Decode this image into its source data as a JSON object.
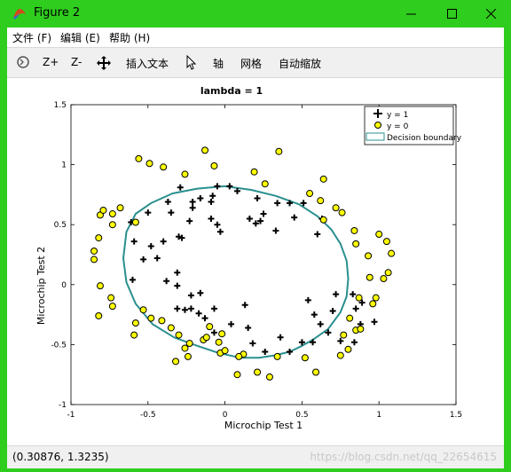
{
  "window": {
    "title": "Figure 2"
  },
  "menu": [
    {
      "label": "文件 (F)"
    },
    {
      "label": "编辑 (E)"
    },
    {
      "label": "帮助 (H)"
    }
  ],
  "toolbar": {
    "zoom_in": "Z+",
    "zoom_out": "Z-",
    "insert_text": "插入文本",
    "axis": "轴",
    "grid": "网格",
    "autoscale": "自动缩放"
  },
  "status": {
    "coordinates": "(0.30876, 1.3235)",
    "watermark": "https://blog.csdn.net/qq_22654615"
  },
  "colors": {
    "title_bar": "#2fcd1e",
    "boundary": "#2a8f8f",
    "negative_fill": "#ffff00"
  },
  "chart_data": {
    "type": "scatter",
    "title": "lambda = 1",
    "xlabel": "Microchip Test 1",
    "ylabel": "Microchip Test 2",
    "xlim": [
      -1,
      1.5
    ],
    "ylim": [
      -1,
      1.5
    ],
    "xticks": [
      "-1",
      "-0.5",
      "0",
      "0.5",
      "1",
      "1.5"
    ],
    "yticks": [
      "-1",
      "-0.5",
      "0",
      "0.5",
      "1",
      "1.5"
    ],
    "legend_position": "top-right",
    "legend": [
      "y = 1",
      "y = 0",
      "Decision boundary"
    ],
    "series": [
      {
        "name": "y = 1",
        "marker": "plus",
        "points": [
          [
            -0.09,
            0.69
          ],
          [
            -0.21,
            0.69
          ],
          [
            -0.29,
            0.81
          ],
          [
            -0.37,
            0.69
          ],
          [
            -0.09,
            0.55
          ],
          [
            0.16,
            0.55
          ],
          [
            0.08,
            0.78
          ],
          [
            0.21,
            0.72
          ],
          [
            0.2,
            0.51
          ],
          [
            0.33,
            0.45
          ],
          [
            0.34,
            0.68
          ],
          [
            0.42,
            0.68
          ],
          [
            0.23,
            0.53
          ],
          [
            0.03,
            0.82
          ],
          [
            -0.05,
            0.82
          ],
          [
            -0.08,
            0.74
          ],
          [
            -0.16,
            0.72
          ],
          [
            -0.21,
            0.64
          ],
          [
            -0.23,
            0.53
          ],
          [
            -0.28,
            0.39
          ],
          [
            -0.35,
            0.6
          ],
          [
            -0.5,
            0.6
          ],
          [
            -0.48,
            0.32
          ],
          [
            -0.59,
            0.36
          ],
          [
            -0.6,
            0.04
          ],
          [
            -0.61,
            0.52
          ],
          [
            -0.53,
            0.21
          ],
          [
            -0.44,
            0.22
          ],
          [
            -0.4,
            0.36
          ],
          [
            -0.38,
            0.03
          ],
          [
            -0.31,
            0.1
          ],
          [
            -0.31,
            -0.01
          ],
          [
            -0.31,
            -0.2
          ],
          [
            -0.26,
            -0.21
          ],
          [
            -0.22,
            -0.09
          ],
          [
            -0.16,
            -0.07
          ],
          [
            -0.17,
            -0.24
          ],
          [
            -0.22,
            -0.2
          ],
          [
            -0.13,
            -0.28
          ],
          [
            -0.07,
            -0.2
          ],
          [
            -0.07,
            -0.4
          ],
          [
            0.04,
            -0.33
          ],
          [
            0.13,
            -0.17
          ],
          [
            0.15,
            -0.36
          ],
          [
            0.18,
            -0.49
          ],
          [
            0.26,
            -0.56
          ],
          [
            0.36,
            -0.44
          ],
          [
            0.42,
            -0.56
          ],
          [
            0.5,
            -0.48
          ],
          [
            0.57,
            -0.48
          ],
          [
            0.62,
            -0.33
          ],
          [
            0.7,
            -0.22
          ],
          [
            0.72,
            -0.08
          ],
          [
            0.83,
            -0.08
          ],
          [
            0.89,
            -0.15
          ],
          [
            0.88,
            -0.33
          ],
          [
            0.84,
            -0.48
          ],
          [
            0.75,
            -0.47
          ],
          [
            0.54,
            -0.13
          ],
          [
            0.58,
            -0.25
          ],
          [
            0.67,
            -0.4
          ],
          [
            0.85,
            -0.2
          ],
          [
            0.97,
            -0.31
          ],
          [
            0.51,
            0.68
          ],
          [
            0.45,
            0.56
          ],
          [
            0.63,
            0.55
          ],
          [
            0.6,
            0.42
          ],
          [
            0.25,
            0.59
          ],
          [
            -0.03,
            0.44
          ],
          [
            -0.05,
            0.5
          ],
          [
            -0.3,
            0.4
          ]
        ]
      },
      {
        "name": "y = 0",
        "marker": "circle",
        "points": [
          [
            -0.13,
            1.12
          ],
          [
            -0.07,
            0.99
          ],
          [
            -0.26,
            0.92
          ],
          [
            -0.49,
            1.01
          ],
          [
            -0.56,
            1.05
          ],
          [
            -0.4,
            0.98
          ],
          [
            0.19,
            0.94
          ],
          [
            0.26,
            0.84
          ],
          [
            0.35,
            1.11
          ],
          [
            0.55,
            0.76
          ],
          [
            0.64,
            0.88
          ],
          [
            0.62,
            0.7
          ],
          [
            0.72,
            0.64
          ],
          [
            0.64,
            0.54
          ],
          [
            0.76,
            0.6
          ],
          [
            0.84,
            0.45
          ],
          [
            0.85,
            0.34
          ],
          [
            0.93,
            0.24
          ],
          [
            1.0,
            0.42
          ],
          [
            1.05,
            0.36
          ],
          [
            1.08,
            0.26
          ],
          [
            0.94,
            0.06
          ],
          [
            0.87,
            -0.11
          ],
          [
            0.81,
            -0.28
          ],
          [
            0.85,
            -0.38
          ],
          [
            0.77,
            -0.42
          ],
          [
            0.75,
            -0.59
          ],
          [
            0.8,
            -0.54
          ],
          [
            0.88,
            -0.37
          ],
          [
            0.96,
            -0.16
          ],
          [
            0.98,
            -0.11
          ],
          [
            1.03,
            0.05
          ],
          [
            1.06,
            0.1
          ],
          [
            0.59,
            -0.73
          ],
          [
            0.52,
            -0.61
          ],
          [
            0.34,
            -0.6
          ],
          [
            0.29,
            -0.77
          ],
          [
            0.08,
            -0.75
          ],
          [
            0.12,
            -0.58
          ],
          [
            -0.03,
            -0.57
          ],
          [
            -0.14,
            -0.46
          ],
          [
            -0.23,
            -0.49
          ],
          [
            -0.32,
            -0.64
          ],
          [
            -0.24,
            -0.6
          ],
          [
            -0.58,
            -0.32
          ],
          [
            -0.59,
            -0.42
          ],
          [
            -0.73,
            -0.18
          ],
          [
            -0.82,
            -0.26
          ],
          [
            -0.74,
            -0.11
          ],
          [
            -0.81,
            -0.01
          ],
          [
            -0.85,
            0.21
          ],
          [
            -0.82,
            0.39
          ],
          [
            -0.73,
            0.5
          ],
          [
            -0.73,
            0.59
          ],
          [
            -0.68,
            0.64
          ],
          [
            -0.81,
            0.58
          ],
          [
            -0.58,
            0.52
          ],
          [
            -0.85,
            0.28
          ],
          [
            -0.79,
            0.62
          ],
          [
            -0.35,
            -0.36
          ],
          [
            -0.3,
            -0.42
          ],
          [
            -0.12,
            -0.44
          ],
          [
            -0.02,
            -0.41
          ],
          [
            0.0,
            -0.55
          ],
          [
            -0.1,
            -0.35
          ],
          [
            0.21,
            -0.73
          ],
          [
            -0.41,
            -0.3
          ],
          [
            -0.53,
            -0.21
          ],
          [
            -0.48,
            -0.28
          ],
          [
            -0.26,
            -0.53
          ],
          [
            -0.04,
            -0.48
          ],
          [
            0.09,
            -0.6
          ]
        ]
      }
    ],
    "boundary": [
      [
        -0.64,
        0.44
      ],
      [
        -0.58,
        0.59
      ],
      [
        -0.48,
        0.68
      ],
      [
        -0.34,
        0.76
      ],
      [
        -0.18,
        0.8
      ],
      [
        0.0,
        0.82
      ],
      [
        0.17,
        0.79
      ],
      [
        0.33,
        0.74
      ],
      [
        0.48,
        0.67
      ],
      [
        0.6,
        0.57
      ],
      [
        0.69,
        0.46
      ],
      [
        0.75,
        0.34
      ],
      [
        0.79,
        0.2
      ],
      [
        0.8,
        0.05
      ],
      [
        0.79,
        -0.1
      ],
      [
        0.75,
        -0.23
      ],
      [
        0.67,
        -0.37
      ],
      [
        0.57,
        -0.46
      ],
      [
        0.5,
        -0.51
      ],
      [
        0.42,
        -0.56
      ],
      [
        0.32,
        -0.59
      ],
      [
        0.22,
        -0.61
      ],
      [
        0.1,
        -0.61
      ],
      [
        -0.04,
        -0.57
      ],
      [
        -0.18,
        -0.51
      ],
      [
        -0.33,
        -0.44
      ],
      [
        -0.47,
        -0.33
      ],
      [
        -0.58,
        -0.16
      ],
      [
        -0.64,
        0.02
      ],
      [
        -0.66,
        0.22
      ],
      [
        -0.64,
        0.44
      ]
    ]
  }
}
